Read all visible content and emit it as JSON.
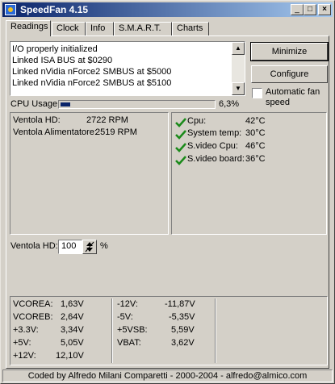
{
  "window": {
    "title": "SpeedFan 4.15"
  },
  "caption_buttons": {
    "minimize": "_",
    "maximize": "□",
    "close": "×"
  },
  "tabs": [
    {
      "label": "Readings"
    },
    {
      "label": "Clock"
    },
    {
      "label": "Info"
    },
    {
      "label": "S.M.A.R.T."
    },
    {
      "label": "Charts"
    }
  ],
  "log": {
    "lines": [
      "I/O properly initialized",
      "Linked ISA BUS at $0290",
      "Linked nVidia nForce2 SMBUS at $5000",
      "Linked nVidia nForce2 SMBUS at $5100"
    ]
  },
  "buttons": {
    "minimize": "Minimize",
    "configure": "Configure"
  },
  "automatic_fan_speed": {
    "label_line1": "Automatic fan",
    "label_line2": "speed",
    "checked": false
  },
  "cpu_usage": {
    "label": "CPU Usage",
    "value": "6,3%",
    "fraction": 0.063
  },
  "fans": [
    {
      "name": "Ventola HD:",
      "value": "2722 RPM"
    },
    {
      "name": "Ventola Alimentatore:",
      "value": "2519 RPM"
    }
  ],
  "temps": [
    {
      "name": "Cpu:",
      "value": "42°C",
      "status": "ok"
    },
    {
      "name": "System temp:",
      "value": "30°C",
      "status": "ok"
    },
    {
      "name": "S.video Cpu:",
      "value": "46°C",
      "status": "ok"
    },
    {
      "name": "S.video board:",
      "value": "36°C",
      "status": "ok"
    }
  ],
  "fan_control": {
    "label": "Ventola HD:",
    "value": "100",
    "unit": "%"
  },
  "voltages_left": [
    {
      "name": "VCOREA:",
      "value": "1,63V"
    },
    {
      "name": "VCOREB:",
      "value": "2,64V"
    },
    {
      "name": "+3.3V:",
      "value": "3,34V"
    },
    {
      "name": "+5V:",
      "value": "5,05V"
    },
    {
      "name": "+12V:",
      "value": "12,10V"
    }
  ],
  "voltages_right": [
    {
      "name": "-12V:",
      "value": "-11,87V"
    },
    {
      "name": "-5V:",
      "value": "-5,35V"
    },
    {
      "name": "+5VSB:",
      "value": "5,59V"
    },
    {
      "name": "VBAT:",
      "value": "3,62V"
    }
  ],
  "status_bar": {
    "text": "Coded by Alfredo Milani Comparetti - 2000-2004 - alfredo@almico.com"
  },
  "colors": {
    "check_green": "#1a8a1a",
    "title_start": "#0a246a",
    "title_end": "#a6caf0",
    "cpu_fill": "#0a246a"
  }
}
